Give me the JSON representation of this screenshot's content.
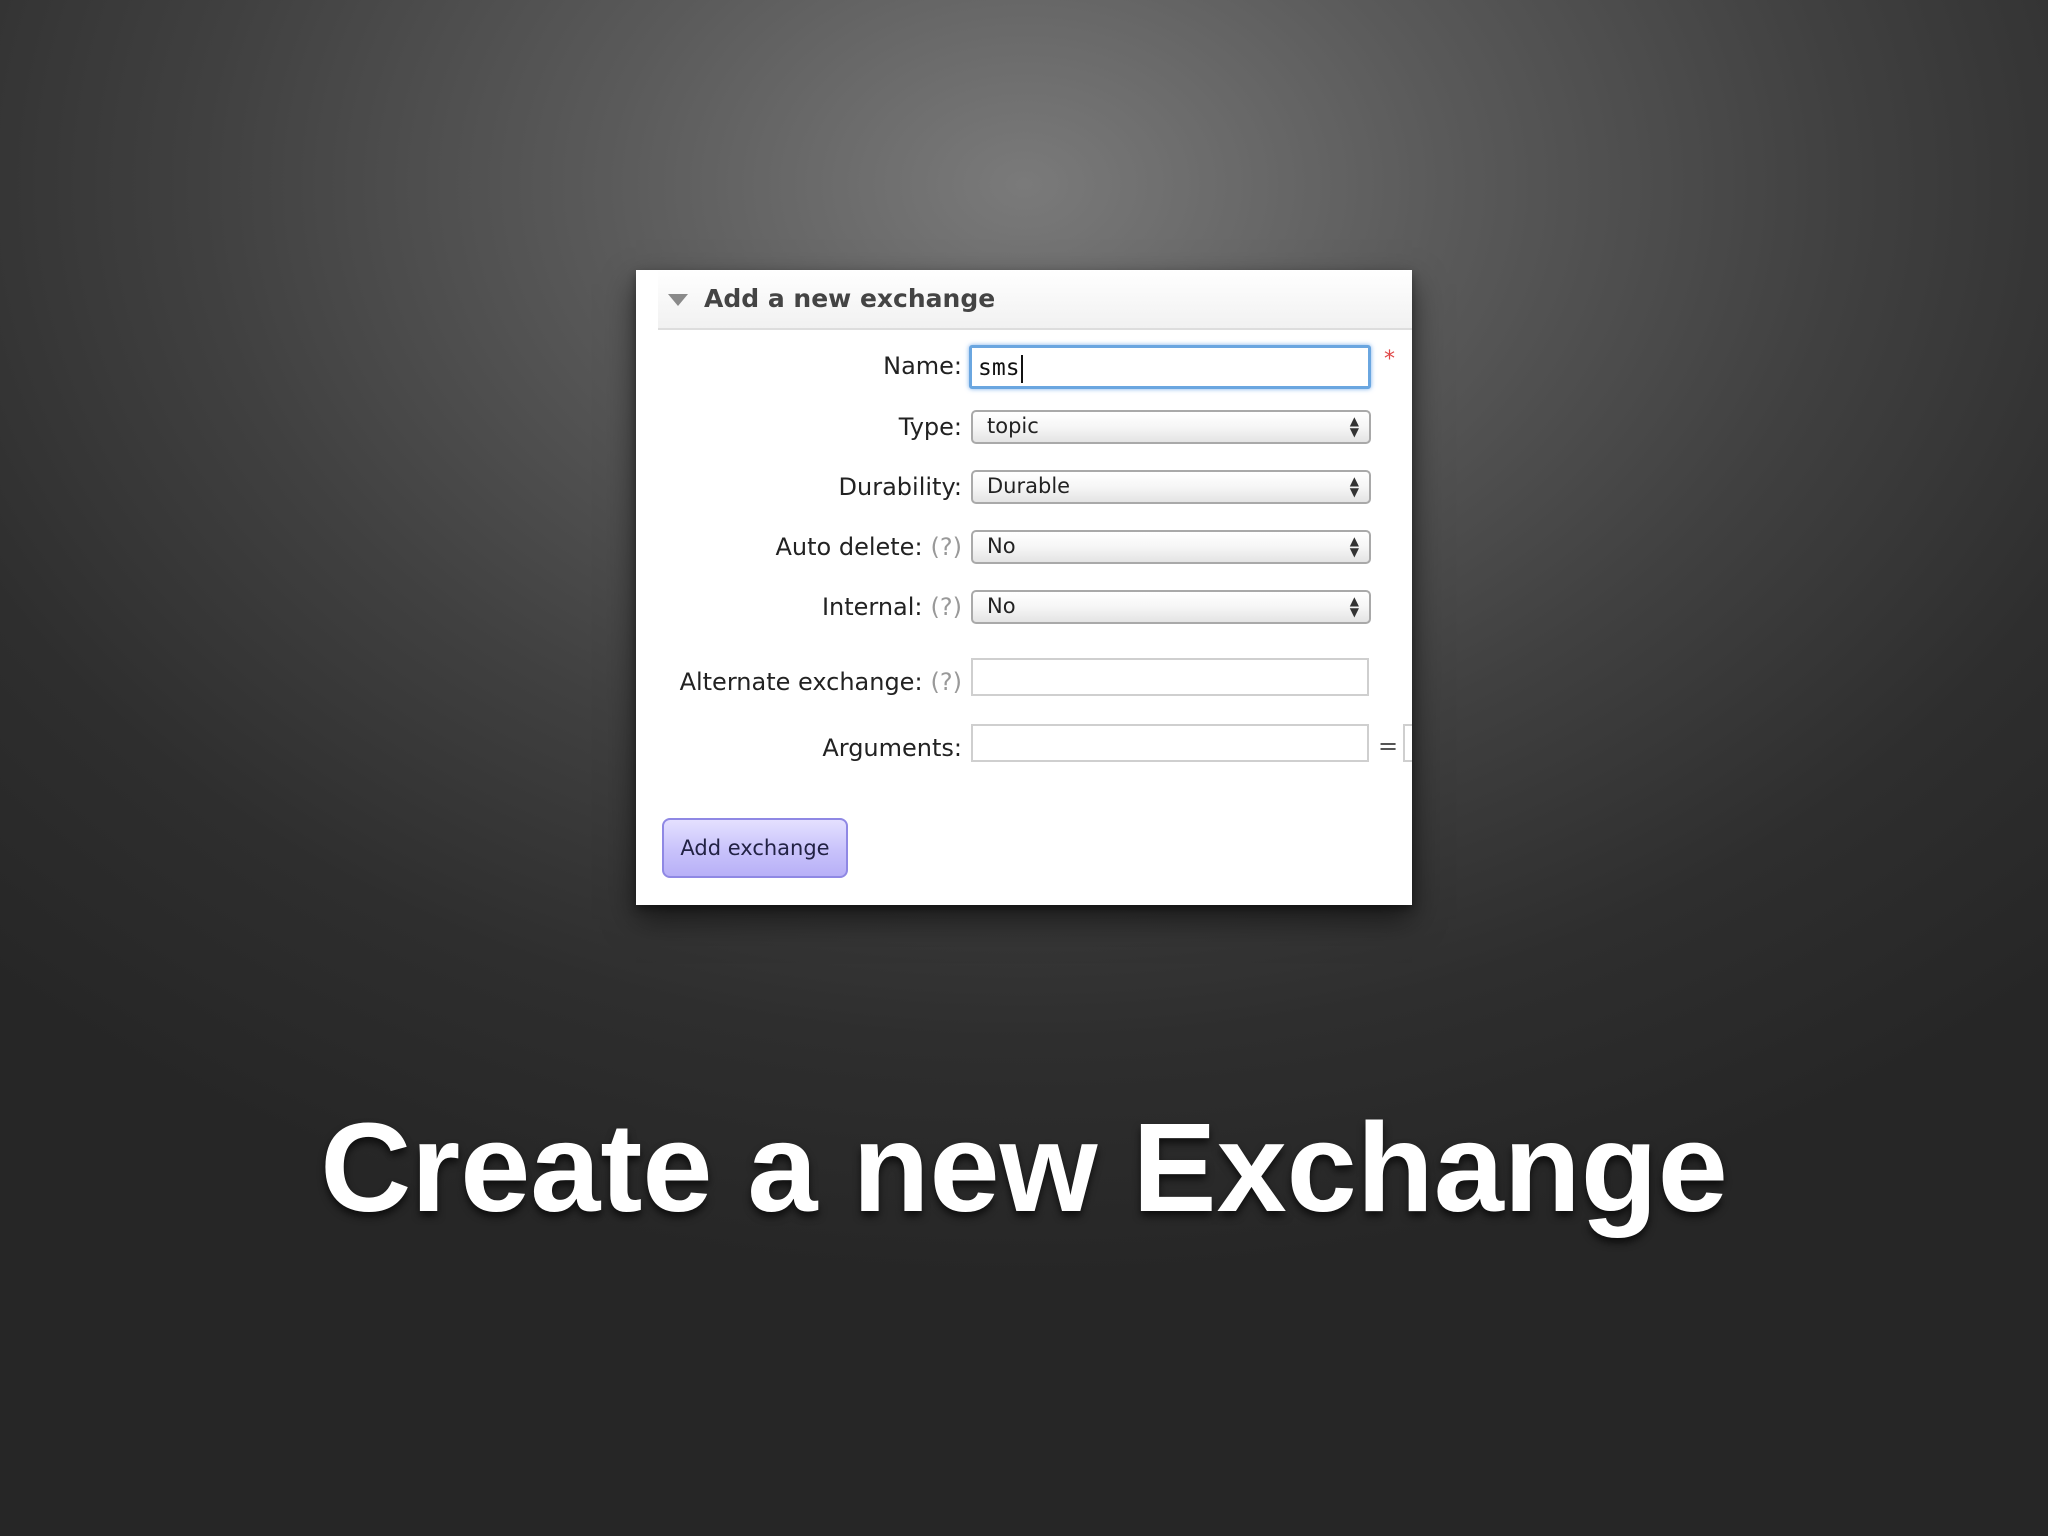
{
  "panel": {
    "title": "Add a new exchange",
    "name_label": "Name:",
    "name_value": "sms",
    "required_mark": "*",
    "type_label": "Type:",
    "type_value": "topic",
    "durability_label": "Durability:",
    "durability_value": "Durable",
    "auto_delete_label": "Auto delete:",
    "auto_delete_value": "No",
    "internal_label": "Internal:",
    "internal_value": "No",
    "alternate_label": "Alternate exchange:",
    "alternate_value": "",
    "help_mark": "(?)",
    "arguments_label": "Arguments:",
    "arguments_value": "",
    "equals": "=",
    "submit_label": "Add exchange"
  },
  "slide": {
    "title": "Create a new Exchange"
  },
  "colors": {
    "focus_ring": "#6aa6e0",
    "button_fill": "#c8c2fb",
    "required": "#e04848"
  }
}
